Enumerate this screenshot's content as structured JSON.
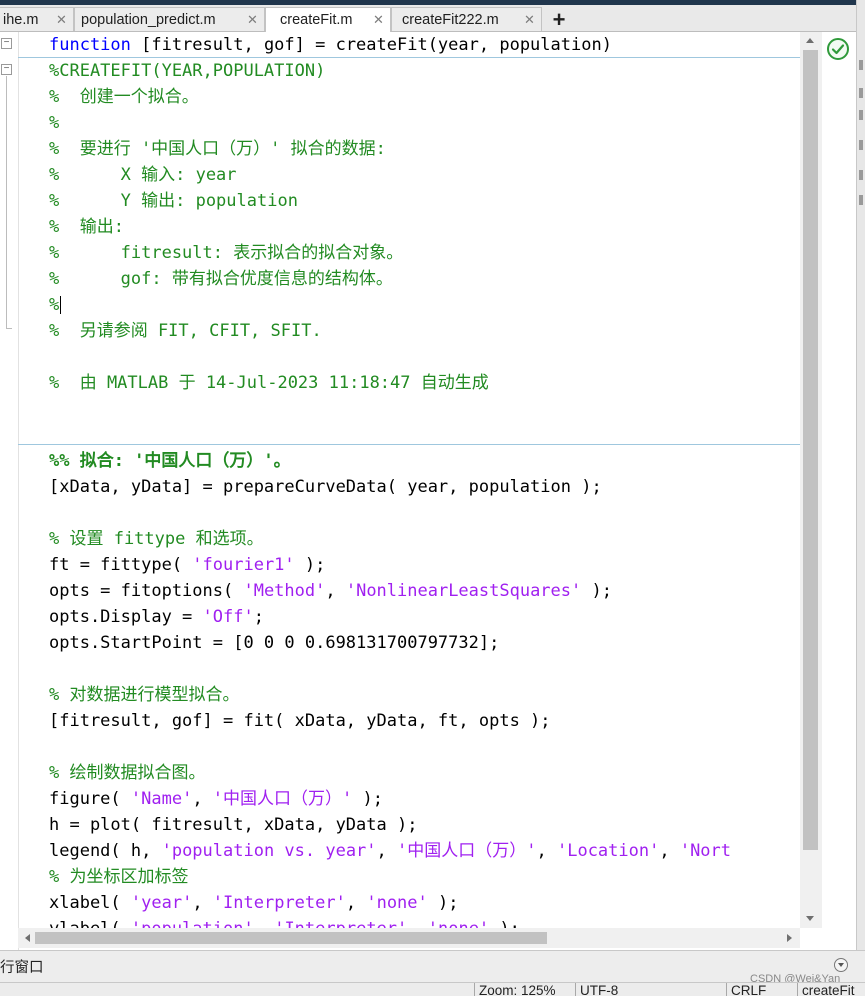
{
  "tabs": [
    {
      "label": "ihe.m",
      "active": false
    },
    {
      "label": "population_predict.m",
      "active": false
    },
    {
      "label": "createFit.m",
      "active": true
    },
    {
      "label": "createFit222.m",
      "active": false
    }
  ],
  "new_tab_label": "+",
  "tab_close_glyph": "✕",
  "fold_collapse_glyph": "−",
  "code_lines": {
    "l1_kw": "function",
    "l1_rest": " [fitresult, gof] = createFit(year, population)",
    "l2": "%CREATEFIT(YEAR,POPULATION)",
    "l3": "%  创建一个拟合。",
    "l4": "%",
    "l5": "%  要进行 '中国人口（万）' 拟合的数据:",
    "l6": "%      X 输入: year",
    "l7": "%      Y 输出: population",
    "l8": "%  输出:",
    "l9": "%      fitresult: 表示拟合的拟合对象。",
    "l10": "%      gof: 带有拟合优度信息的结构体。",
    "l11": "%",
    "l12": "%  另请参阅 FIT, CFIT, SFIT.",
    "l14": "%  由 MATLAB 于 14-Jul-2023 11:18:47 自动生成",
    "l17": "%% 拟合: '中国人口（万）'。",
    "l18": "[xData, yData] = prepareCurveData( year, population );",
    "l20": "% 设置 fittype 和选项。",
    "l21a": "ft = fittype( ",
    "l21s": "'fourier1'",
    "l21b": " );",
    "l22a": "opts = fitoptions( ",
    "l22s1": "'Method'",
    "l22m": ", ",
    "l22s2": "'NonlinearLeastSquares'",
    "l22b": " );",
    "l23a": "opts.Display = ",
    "l23s": "'Off'",
    "l23b": ";",
    "l24": "opts.StartPoint = [0 0 0 0.698131700797732];",
    "l26": "% 对数据进行模型拟合。",
    "l27": "[fitresult, gof] = fit( xData, yData, ft, opts );",
    "l29": "% 绘制数据拟合图。",
    "l30a": "figure( ",
    "l30s1": "'Name'",
    "l30m": ", ",
    "l30s2": "'中国人口（万）'",
    "l30b": " );",
    "l31": "h = plot( fitresult, xData, yData );",
    "l32a": "legend( h, ",
    "l32s1": "'population vs. year'",
    "l32m1": ", ",
    "l32s2": "'中国人口（万）'",
    "l32m2": ", ",
    "l32s3": "'Location'",
    "l32m3": ", ",
    "l32s4": "'Nort",
    "l33": "% 为坐标区加标签",
    "l34a": "xlabel( ",
    "l34s1": "'year'",
    "l34m1": ", ",
    "l34s2": "'Interpreter'",
    "l34m2": ", ",
    "l34s3": "'none'",
    "l34b": " );",
    "l35a": "ylabel( ",
    "l35s1": "'population'",
    "l35m1": ", ",
    "l35s2": "'Interpreter'",
    "l35m2": ", ",
    "l35s3": "'none'",
    "l35b": " );"
  },
  "bottom": {
    "command_window_label": "行窗口",
    "zoom": "Zoom: 125%",
    "encoding": "UTF-8",
    "line_ending": "CRLF",
    "file_label": "createFit",
    "watermark": "CSDN @Wei&Yan"
  },
  "colors": {
    "comment": "#228b22",
    "keyword": "#0000ff",
    "string": "#a020f0",
    "status_ok": "#2f9a3a"
  }
}
